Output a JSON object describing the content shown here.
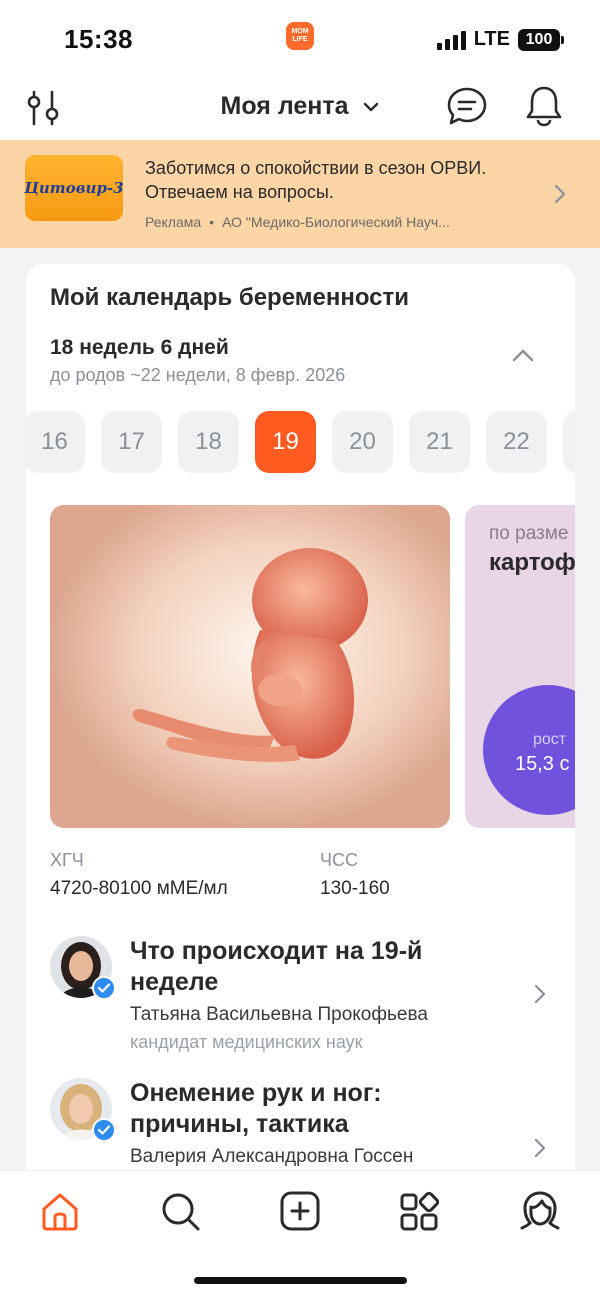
{
  "status_bar": {
    "time": "15:38",
    "app_icon_text": "MOM LIFE",
    "network": "LTE",
    "battery": "100"
  },
  "header": {
    "title": "Моя лента",
    "icons": [
      "filter-icon",
      "chevron-down-icon",
      "chat-icon",
      "bell-icon"
    ]
  },
  "ad": {
    "brand": "Цитовир-3",
    "text": "Заботимся о спокойствии в сезон ОРВИ. Отвечаем на вопросы.",
    "label": "Реклама",
    "advertiser": "АО \"Медико-Биологический Науч..."
  },
  "pregnancy": {
    "title": "Мой календарь беременности",
    "current": "18 недель 6 дней",
    "remaining": "до родов ~22 недели, 8 февр. 2026",
    "weeks": [
      "16",
      "17",
      "18",
      "19",
      "20",
      "21",
      "22"
    ],
    "active_week": "19",
    "size_label": "по разме",
    "size_value": "картоф",
    "growth_label": "рост",
    "growth_value": "15,3 с",
    "metrics": [
      {
        "label": "ХГЧ",
        "value": "4720-80100 мМЕ/мл"
      },
      {
        "label": "ЧСС",
        "value": "130-160"
      }
    ]
  },
  "articles": [
    {
      "title": "Что происходит на 19-й неделе",
      "author": "Татьяна Васильевна Прокофьева",
      "degree": "кандидат медицинских наук"
    },
    {
      "title": "Онемение рук и ног: причины, тактика",
      "author": "Валерия Александровна Госсен"
    }
  ],
  "bottom_nav": [
    "home-icon",
    "search-icon",
    "add-icon",
    "services-icon",
    "profile-icon"
  ],
  "colors": {
    "accent": "#ff5a1f",
    "ad_background": "#fbd5a5",
    "size_card": "#e8d5e6",
    "growth_circle": "#7052dc",
    "verified": "#2e8bf0"
  }
}
